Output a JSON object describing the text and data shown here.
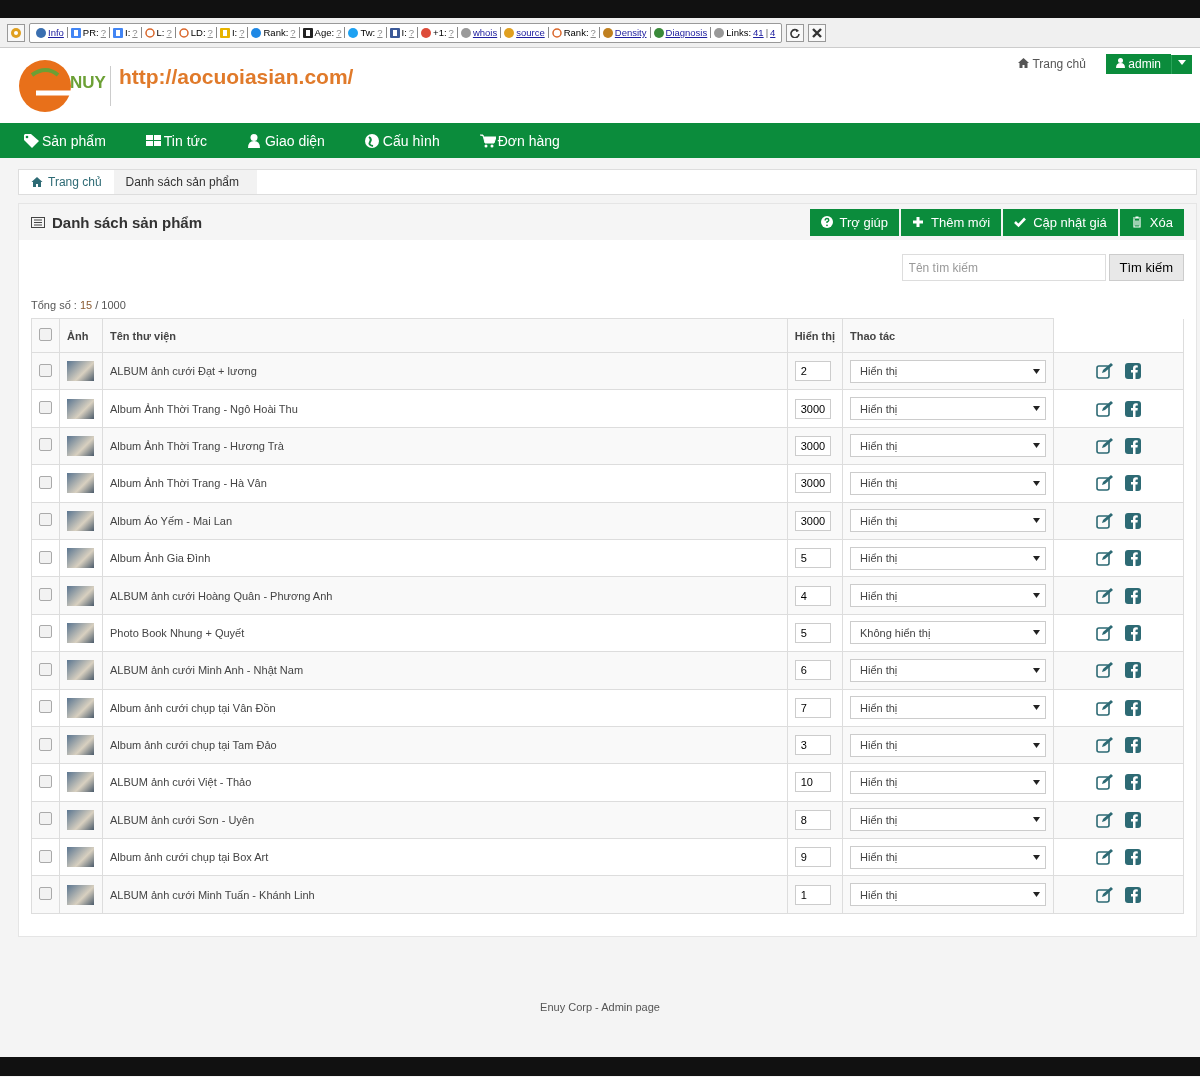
{
  "toolbar": {
    "items": [
      {
        "kind": "link",
        "label": "Info"
      },
      {
        "kind": "metric",
        "label": "PR:",
        "values": [
          "?"
        ]
      },
      {
        "kind": "metric",
        "label": "I:",
        "values": [
          "?"
        ]
      },
      {
        "kind": "metric",
        "label": "L:",
        "values": [
          "?"
        ]
      },
      {
        "kind": "metric",
        "label": "LD:",
        "values": [
          "?"
        ]
      },
      {
        "kind": "metric",
        "label": "I:",
        "values": [
          "?"
        ]
      },
      {
        "kind": "metric",
        "label": "Rank:",
        "values": [
          "?"
        ]
      },
      {
        "kind": "metric",
        "label": "Age:",
        "values": [
          "?"
        ]
      },
      {
        "kind": "metric",
        "label": "Tw:",
        "values": [
          "?"
        ]
      },
      {
        "kind": "metric",
        "label": "I:",
        "values": [
          "?"
        ]
      },
      {
        "kind": "metric",
        "label": "+1:",
        "values": [
          "?"
        ]
      },
      {
        "kind": "link",
        "label": "whois"
      },
      {
        "kind": "link",
        "label": "source"
      },
      {
        "kind": "metric",
        "label": "Rank:",
        "values": [
          "?"
        ]
      },
      {
        "kind": "link",
        "label": "Density"
      },
      {
        "kind": "link",
        "label": "Diagnosis"
      },
      {
        "kind": "metric",
        "label": "Links:",
        "values": [
          "41",
          "4"
        ],
        "separator": "|"
      }
    ]
  },
  "header": {
    "logo_text": "NUY",
    "site_url": "http://aocuoiasian.com/",
    "home_link": "Trang chủ",
    "user": "admin"
  },
  "nav": [
    "Sản phẩm",
    "Tin tức",
    "Giao diện",
    "Cấu hình",
    "Đơn hàng"
  ],
  "breadcrumb": [
    {
      "label": "Trang chủ",
      "selected": false
    },
    {
      "label": "Danh sách sản phẩm",
      "selected": true
    }
  ],
  "panel": {
    "title": "Danh sách sản phẩm",
    "buttons": [
      "Trợ giúp",
      "Thêm mới",
      "Cập nhật giá",
      "Xóa"
    ],
    "search": {
      "placeholder": "Tên tìm kiếm",
      "button": "Tìm kiếm"
    },
    "total_label": "Tổng số :",
    "total_count": "15",
    "total_max": "/ 1000"
  },
  "table": {
    "columns": [
      "Ảnh",
      "Tên thư viện",
      "Hiển thị",
      "Thao tác"
    ],
    "header_checked": false,
    "rows": [
      {
        "checked": false,
        "name": "ALBUM ảnh cưới Đạt + lương",
        "order": "2",
        "status": "Hiển thị"
      },
      {
        "checked": false,
        "name": "Album Ảnh Thời Trang - Ngô Hoài Thu",
        "order": "3000",
        "status": "Hiển thị"
      },
      {
        "checked": false,
        "name": "Album Ảnh Thời Trang - Hương Trà",
        "order": "3000",
        "status": "Hiển thị"
      },
      {
        "checked": false,
        "name": "Album Ảnh Thời Trang - Hà Vân",
        "order": "3000",
        "status": "Hiển thị"
      },
      {
        "checked": false,
        "name": "Album Áo Yếm - Mai Lan",
        "order": "3000",
        "status": "Hiển thị"
      },
      {
        "checked": false,
        "name": "Album Ảnh Gia Đình",
        "order": "5",
        "status": "Hiển thị"
      },
      {
        "checked": false,
        "name": "ALBUM ảnh cưới Hoàng Quân - Phương Anh",
        "order": "4",
        "status": "Hiển thị"
      },
      {
        "checked": false,
        "name": "Photo Book Nhung + Quyết",
        "order": "5",
        "status": "Không hiển thị"
      },
      {
        "checked": false,
        "name": "ALBUM ảnh cưới Minh Anh - Nhật Nam",
        "order": "6",
        "status": "Hiển thị"
      },
      {
        "checked": false,
        "name": "Album ảnh cưới chụp tại Vân Đồn",
        "order": "7",
        "status": "Hiển thị"
      },
      {
        "checked": false,
        "name": "Album ảnh cưới chụp tại Tam Đảo",
        "order": "3",
        "status": "Hiển thị"
      },
      {
        "checked": false,
        "name": "ALBUM ảnh cưới Việt - Thảo",
        "order": "10",
        "status": "Hiển thị"
      },
      {
        "checked": false,
        "name": "ALBUM ảnh cưới Sơn - Uyên",
        "order": "8",
        "status": "Hiển thị"
      },
      {
        "checked": false,
        "name": "Album ảnh cưới chụp tại Box Art",
        "order": "9",
        "status": "Hiển thị"
      },
      {
        "checked": false,
        "name": "ALBUM ảnh cưới Minh Tuấn - Khánh Linh",
        "order": "1",
        "status": "Hiển thị"
      }
    ]
  },
  "footer": "Enuy Corp - Admin page"
}
